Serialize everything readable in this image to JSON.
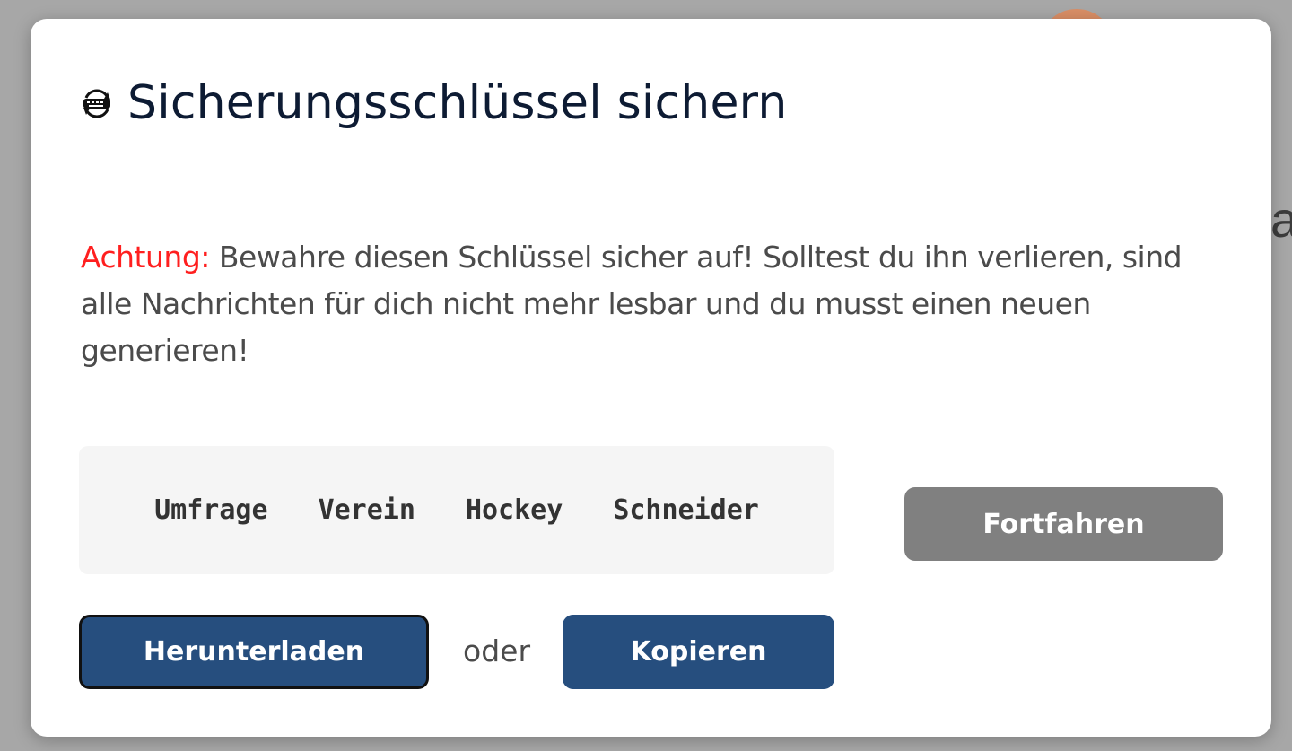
{
  "background": {
    "partial_text": "a"
  },
  "dialog": {
    "title": "Sicherungsschlüssel sichern",
    "title_icon": "key-sync-icon",
    "warning_label": "Achtung:",
    "warning_text": " Bewahre diesen Schlüssel sicher auf! Solltest du ihn verlieren, sind alle Nachrichten für dich nicht mehr lesbar und du musst einen neuen generieren!",
    "key_words": [
      "Umfrage",
      "Verein",
      "Hockey",
      "Schneider"
    ],
    "continue_label": "Fortfahren",
    "download_label": "Herunterladen",
    "or_label": "oder",
    "copy_label": "Kopieren"
  },
  "colors": {
    "primary_button": "#264e7e",
    "disabled_button": "#808080",
    "warning": "#ff1f1f",
    "title": "#0d1b33"
  }
}
